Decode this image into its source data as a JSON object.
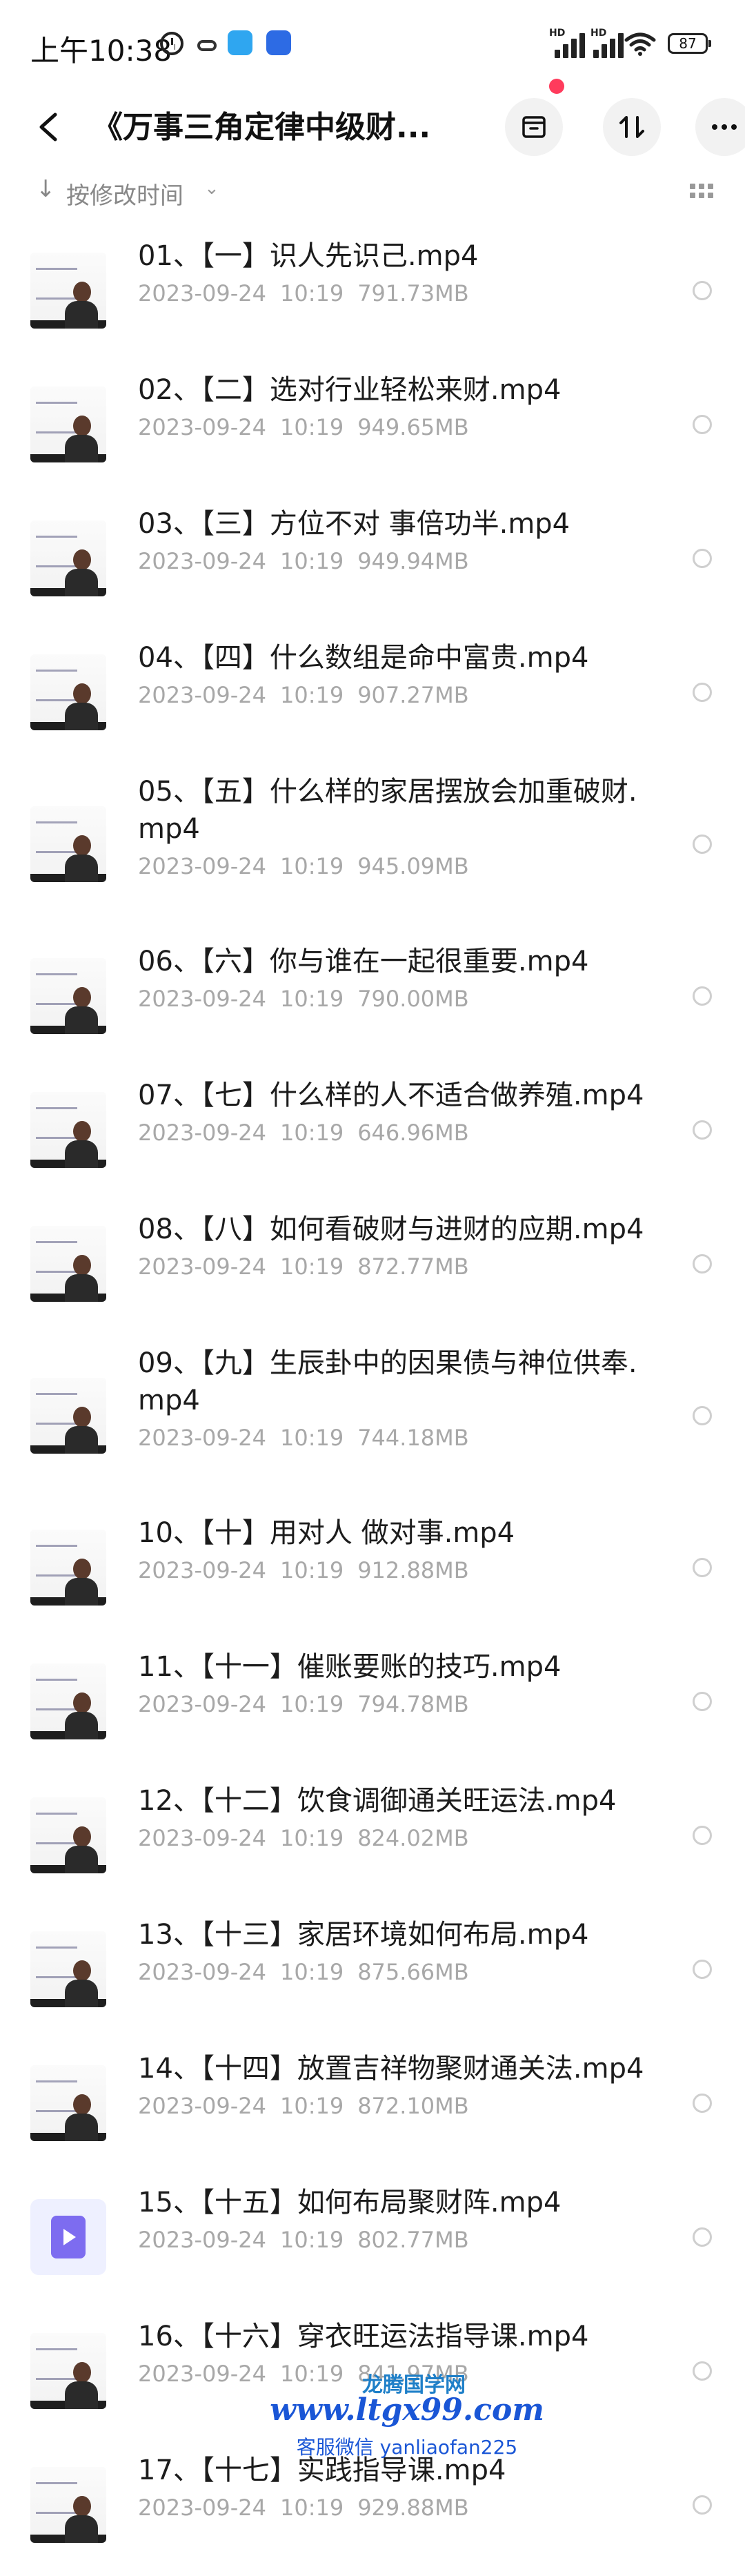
{
  "status_bar": {
    "time": "上午10:38",
    "hd1": "HD",
    "hd2": "HD",
    "battery": "87"
  },
  "header": {
    "title": "《万事三角定律中级财..."
  },
  "sort": {
    "label": "按修改时间"
  },
  "files": [
    {
      "name": "01、【一】识人先识己.mp4",
      "date": "2023-09-24",
      "time": "10:19",
      "size": "791.73MB",
      "thumb": "lecture"
    },
    {
      "name": "02、【二】选对行业轻松来财.mp4",
      "date": "2023-09-24",
      "time": "10:19",
      "size": "949.65MB",
      "thumb": "lecture"
    },
    {
      "name": "03、【三】方位不对 事倍功半.mp4",
      "date": "2023-09-24",
      "time": "10:19",
      "size": "949.94MB",
      "thumb": "lecture"
    },
    {
      "name": "04、【四】什么数组是命中富贵.mp4",
      "date": "2023-09-24",
      "time": "10:19",
      "size": "907.27MB",
      "thumb": "lecture"
    },
    {
      "name": "05、【五】什么样的家居摆放会加重破财.mp4",
      "date": "2023-09-24",
      "time": "10:19",
      "size": "945.09MB",
      "thumb": "lecture"
    },
    {
      "name": "06、【六】你与谁在一起很重要.mp4",
      "date": "2023-09-24",
      "time": "10:19",
      "size": "790.00MB",
      "thumb": "lecture"
    },
    {
      "name": "07、【七】什么样的人不适合做养殖.mp4",
      "date": "2023-09-24",
      "time": "10:19",
      "size": "646.96MB",
      "thumb": "lecture"
    },
    {
      "name": "08、【八】如何看破财与进财的应期.mp4",
      "date": "2023-09-24",
      "time": "10:19",
      "size": "872.77MB",
      "thumb": "lecture"
    },
    {
      "name": "09、【九】生辰卦中的因果债与神位供奉.mp4",
      "date": "2023-09-24",
      "time": "10:19",
      "size": "744.18MB",
      "thumb": "lecture"
    },
    {
      "name": "10、【十】用对人 做对事.mp4",
      "date": "2023-09-24",
      "time": "10:19",
      "size": "912.88MB",
      "thumb": "lecture"
    },
    {
      "name": "11、【十一】催账要账的技巧.mp4",
      "date": "2023-09-24",
      "time": "10:19",
      "size": "794.78MB",
      "thumb": "lecture"
    },
    {
      "name": "12、【十二】饮食调御通关旺运法.mp4",
      "date": "2023-09-24",
      "time": "10:19",
      "size": "824.02MB",
      "thumb": "lecture"
    },
    {
      "name": "13、【十三】家居环境如何布局.mp4",
      "date": "2023-09-24",
      "time": "10:19",
      "size": "875.66MB",
      "thumb": "lecture"
    },
    {
      "name": "14、【十四】放置吉祥物聚财通关法.mp4",
      "date": "2023-09-24",
      "time": "10:19",
      "size": "872.10MB",
      "thumb": "lecture"
    },
    {
      "name": "15、【十五】如何布局聚财阵.mp4",
      "date": "2023-09-24",
      "time": "10:19",
      "size": "802.77MB",
      "thumb": "video-icon"
    },
    {
      "name": "16、【十六】穿衣旺运法指导课.mp4",
      "date": "2023-09-24",
      "time": "10:19",
      "size": "841.97MB",
      "thumb": "lecture"
    },
    {
      "name": "17、【十七】实践指导课.mp4",
      "date": "2023-09-24",
      "time": "10:19",
      "size": "929.88MB",
      "thumb": "lecture"
    }
  ],
  "watermark": {
    "line1": "龙腾国学网",
    "line2": "www.ltgx99.com",
    "line3": "客服微信 yanliaofan225"
  }
}
